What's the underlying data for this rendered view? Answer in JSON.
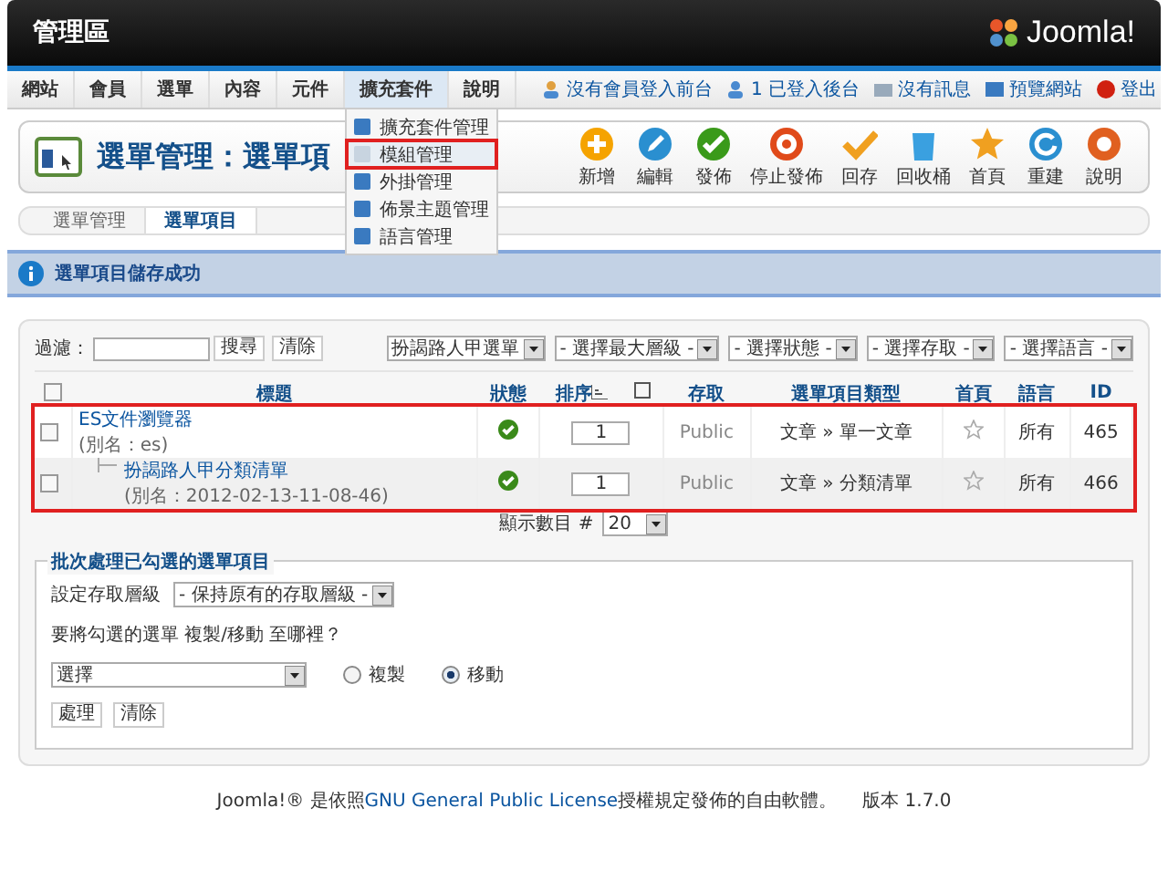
{
  "header": {
    "title": "管理區",
    "logo": "Joomla!"
  },
  "menu": {
    "items": [
      {
        "label": "網站",
        "selected": false
      },
      {
        "label": "會員",
        "selected": false
      },
      {
        "label": "選單",
        "selected": false
      },
      {
        "label": "內容",
        "selected": false
      },
      {
        "label": "元件",
        "selected": false
      },
      {
        "label": "擴充套件",
        "selected": true,
        "dropdown": [
          {
            "label": "擴充套件管理",
            "selected": false
          },
          {
            "label": "模組管理",
            "selected": true
          },
          {
            "label": "外掛管理",
            "selected": false
          },
          {
            "label": "佈景主題管理",
            "selected": false
          },
          {
            "label": "語言管理",
            "selected": false
          }
        ]
      },
      {
        "label": "說明",
        "selected": false
      }
    ],
    "status": [
      {
        "kind": "users",
        "label": "沒有會員登入前台"
      },
      {
        "kind": "admins",
        "label": "1 已登入後台"
      },
      {
        "kind": "messages",
        "label": "沒有訊息"
      },
      {
        "kind": "preview",
        "label": "預覽網站"
      },
      {
        "kind": "logout",
        "label": "登出"
      }
    ]
  },
  "toolbar": {
    "title": "選單管理：選單項",
    "buttons": [
      {
        "kind": "add",
        "label": "新增"
      },
      {
        "kind": "edit",
        "label": "編輯"
      },
      {
        "kind": "publish",
        "label": "發佈"
      },
      {
        "kind": "unpublish",
        "label": "停止發佈"
      },
      {
        "kind": "checkin",
        "label": "回存"
      },
      {
        "kind": "trash",
        "label": "回收桶"
      },
      {
        "kind": "home",
        "label": "首頁"
      },
      {
        "kind": "rebuild",
        "label": "重建"
      },
      {
        "kind": "help",
        "label": "說明"
      }
    ]
  },
  "submenu": [
    {
      "label": "選單管理",
      "selected": false
    },
    {
      "label": "選單項目",
      "selected": true
    }
  ],
  "message": "選單項目儲存成功",
  "filter": {
    "label": "過濾：",
    "buttons": [
      "搜尋",
      "清除"
    ],
    "selects": [
      "扮謁路人甲選單",
      "- 選擇最大層級 -",
      "- 選擇狀態 -",
      "- 選擇存取 -",
      "- 選擇語言 -"
    ]
  },
  "table": {
    "highlighted": true,
    "all_checked": false,
    "columns": [
      "標題",
      "狀態",
      "排序",
      "存取",
      "選單項目類型",
      "首頁",
      "語言",
      "ID"
    ],
    "rows": [
      {
        "title": "ES文件瀏覽器",
        "alias": "(別名：es)",
        "checked": false,
        "published": true,
        "order": "1",
        "access": "Public",
        "type": "文章 » 單一文章",
        "home": false,
        "language": "所有",
        "id": "465",
        "children": [
          {
            "title": "扮謁路人甲分類清單",
            "alias": "(別名：2012-02-13-11-08-46)",
            "checked": false,
            "published": true,
            "order": "1",
            "access": "Public",
            "type": "文章 » 分類清單",
            "home": false,
            "language": "所有",
            "id": "466"
          }
        ]
      }
    ]
  },
  "pagination": {
    "label": "顯示數目 #",
    "value": "20"
  },
  "batch": {
    "legend": "批次處理已勾選的選單項目",
    "access_label": "設定存取層級",
    "access_value": "- 保持原有的存取層級 -",
    "move_label": "要將勾選的選單 複製/移動 至哪裡？",
    "target": "選擇",
    "options": [
      {
        "label": "複製",
        "selected": false
      },
      {
        "label": "移動",
        "selected": true
      }
    ],
    "buttons": [
      "處理",
      "清除"
    ]
  },
  "footer": {
    "before": "Joomla!® 是依照",
    "link": "GNU General Public License",
    "after": "授權規定發佈的自由軟體。",
    "version": "版本 1.7.0"
  }
}
